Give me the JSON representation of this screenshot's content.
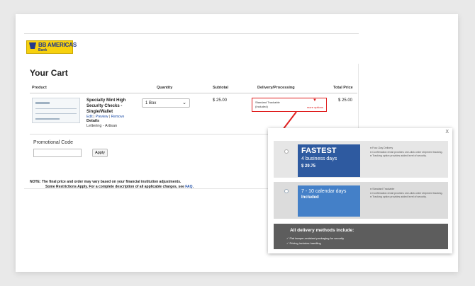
{
  "bank": {
    "name": "BB AMERICAS",
    "sub": "Bank"
  },
  "cart": {
    "title": "Your Cart",
    "headers": {
      "product": "Product",
      "quantity": "Quantity",
      "subtotal": "Subtotal",
      "delivery": "Delivery/Processing",
      "total": "Total Price"
    },
    "item": {
      "name": "Specialty Mint High Security Checks - Single/Wallet",
      "edit": "Edit",
      "preview": "Preview",
      "remove": "Remove",
      "sep": "|",
      "details_label": "Details",
      "details_value": "Lettering - Artisan",
      "quantity": "1 Box",
      "subtotal": "$ 25.00",
      "delivery_option": "Standard Trackable",
      "delivery_note": "(Included)",
      "more_options": "more options",
      "total": "$ 25.00"
    },
    "promo": {
      "label": "Promotional Code",
      "value": "",
      "apply": "Apply"
    },
    "note": {
      "line1": "NOTE: The final price and order may vary based on your financial institution adjustments.",
      "line2": "Some Restrictions Apply. For a complete description of all applicable charges, see",
      "faq": "FAQ",
      "end": "."
    }
  },
  "popup": {
    "close": "X",
    "options": [
      {
        "title": "FASTEST",
        "days": "4 business days",
        "price": "$ 29.75",
        "features": [
          "Four-Day Delivery",
          "Confirmation email provides one-click order shipment tracking.",
          "Tracking option provides added level of security."
        ]
      },
      {
        "title": "7 - 10 calendar days",
        "price": "Included",
        "features": [
          "Standard Trackable",
          "Confirmation email provides one-click order shipment tracking.",
          "Tracking option provides added level of security."
        ]
      }
    ],
    "all": {
      "heading": "All delivery methods include:",
      "items": [
        "✓ Flat tamper-resistant packaging for security",
        "✓ Pricing includes handling"
      ]
    }
  },
  "colors": {
    "highlight": "#e01f1f",
    "fast_bg": "#2e5aa0",
    "standard_bg": "#4480c8",
    "brand_yellow": "#f7d10e"
  }
}
